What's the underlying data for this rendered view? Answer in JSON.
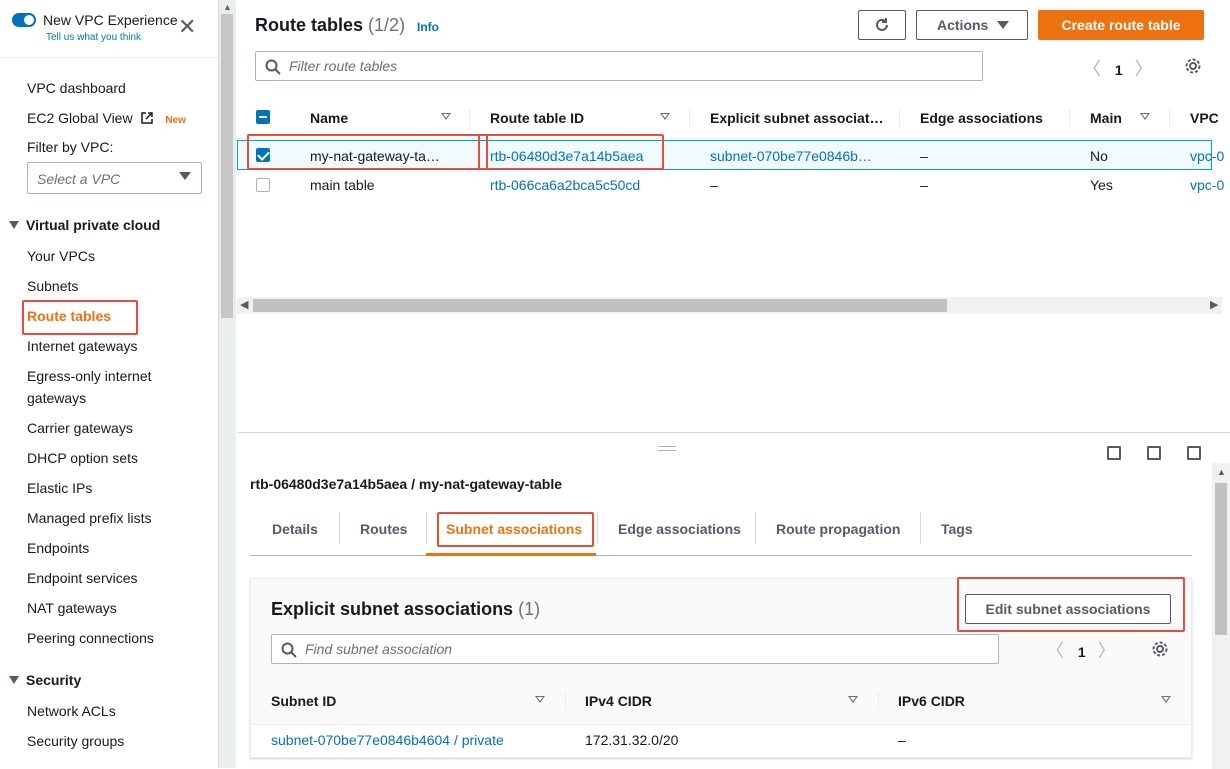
{
  "sidebar": {
    "toggle_title": "New VPC Experience",
    "toggle_sub": "Tell us what you think",
    "dashboard": "VPC dashboard",
    "ec2_global": "EC2 Global View",
    "new_badge": "New",
    "filter_label": "Filter by VPC:",
    "filter_placeholder": "Select a VPC",
    "section_vpc": "Virtual private cloud",
    "items": [
      "Your VPCs",
      "Subnets",
      "Route tables",
      "Internet gateways",
      "Egress-only internet",
      "gateways",
      "Carrier gateways",
      "DHCP option sets",
      "Elastic IPs",
      "Managed prefix lists",
      "Endpoints",
      "Endpoint services",
      "NAT gateways",
      "Peering connections"
    ],
    "section_security": "Security",
    "security_items": [
      "Network ACLs",
      "Security groups"
    ]
  },
  "header": {
    "title": "Route tables",
    "count": "(1/2)",
    "info": "Info",
    "actions_label": "Actions",
    "create_label": "Create route table",
    "search_placeholder": "Filter route tables",
    "page": "1"
  },
  "table": {
    "columns": [
      "Name",
      "Route table ID",
      "Explicit subnet associat…",
      "Edge associations",
      "Main",
      "VPC"
    ],
    "rows": [
      {
        "name": "my-nat-gateway-ta…",
        "id": "rtb-06480d3e7a14b5aea",
        "explicit": "subnet-070be77e0846b…",
        "edge": "–",
        "main": "No",
        "vpc": "vpc-0"
      },
      {
        "name": "main table",
        "id": "rtb-066ca6a2bca5c50cd",
        "explicit": "–",
        "edge": "–",
        "main": "Yes",
        "vpc": "vpc-0"
      }
    ]
  },
  "details": {
    "title": "rtb-06480d3e7a14b5aea / my-nat-gateway-table",
    "tabs": [
      "Details",
      "Routes",
      "Subnet associations",
      "Edge associations",
      "Route propagation",
      "Tags"
    ],
    "card_title": "Explicit subnet associations",
    "card_count": "(1)",
    "edit_label": "Edit subnet associations",
    "search_placeholder": "Find subnet association",
    "page": "1",
    "columns": [
      "Subnet ID",
      "IPv4 CIDR",
      "IPv6 CIDR"
    ],
    "row": {
      "subnet": "subnet-070be77e0846b4604 / private",
      "ipv4": "172.31.32.0/20",
      "ipv6": "–"
    }
  },
  "colors": {
    "accent": "#ec7211",
    "link": "#0073bb",
    "highlight": "#e74c3c"
  }
}
